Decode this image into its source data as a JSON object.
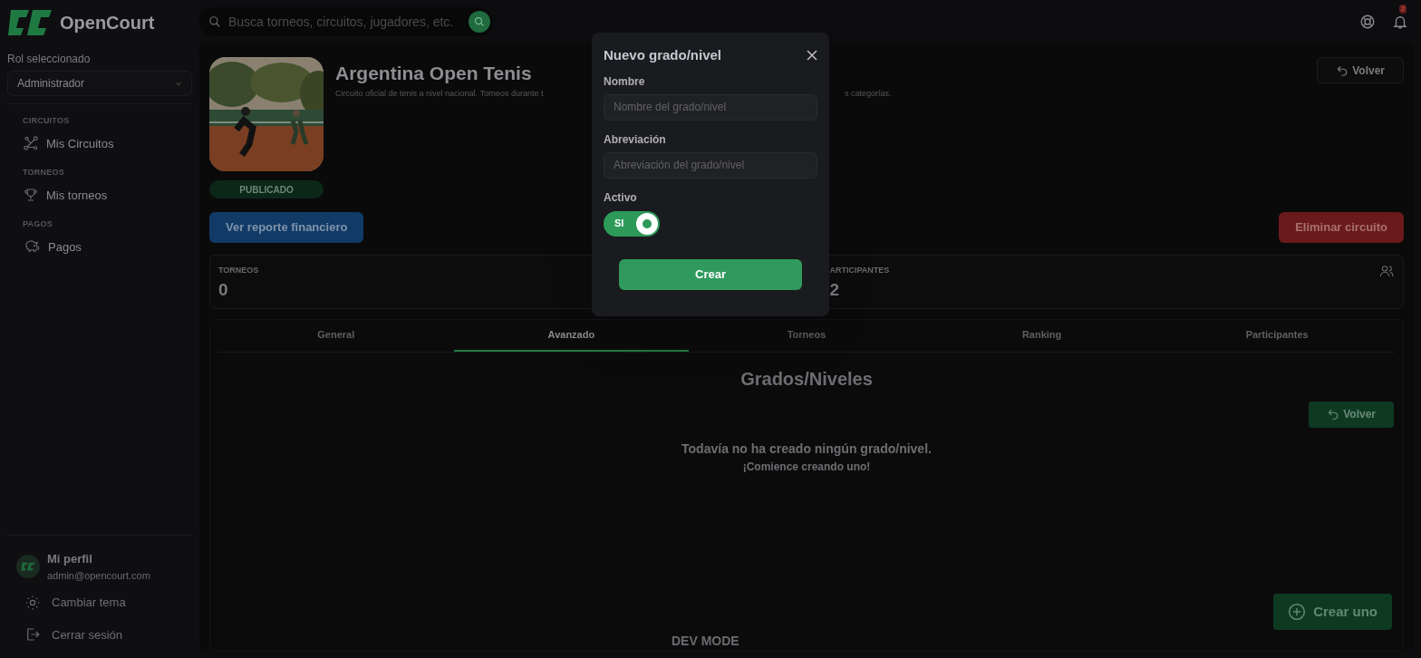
{
  "brand": {
    "name": "OpenCourt"
  },
  "search": {
    "placeholder": "Busca torneos, circuitos, jugadores, etc."
  },
  "notifications": {
    "count": "2"
  },
  "sidebar": {
    "role_label": "Rol seleccionado",
    "role_value": "Administrador",
    "sections": [
      {
        "title": "CIRCUITOS",
        "items": [
          {
            "label": "Mis Circuitos"
          }
        ]
      },
      {
        "title": "TORNEOS",
        "items": [
          {
            "label": "Mis torneos"
          }
        ]
      },
      {
        "title": "PAGOS",
        "items": [
          {
            "label": "Pagos"
          }
        ]
      }
    ],
    "profile": {
      "name": "Mi perfil",
      "email": "admin@opencourt.com"
    },
    "footer_items": [
      {
        "label": "Cambiar tema"
      },
      {
        "label": "Cerrar sesión"
      }
    ]
  },
  "circuit": {
    "title": "Argentina Open Tenis",
    "description_start": "Circuito oficial de tenis a nivel nacional. Torneos durante t",
    "description_end": "s categorías.",
    "status": "PUBLICADO",
    "back_button": "Volver",
    "report_button": "Ver reporte financiero",
    "delete_button": "Eliminar circuito"
  },
  "stats": [
    {
      "label": "TORNEOS",
      "value": "0"
    },
    {
      "label": "ARTICIPANTES",
      "value": "2"
    }
  ],
  "tabs": [
    {
      "label": "General",
      "selected": false
    },
    {
      "label": "Avanzado",
      "selected": true
    },
    {
      "label": "Torneos",
      "selected": false
    },
    {
      "label": "Ranking",
      "selected": false
    },
    {
      "label": "Participantes",
      "selected": false
    }
  ],
  "levels": {
    "title": "Grados/Niveles",
    "back_button": "Volver",
    "empty_title": "Todavía no ha creado ningún grado/nivel.",
    "empty_subtitle": "¡Comience creando uno!",
    "create_button": "Crear uno"
  },
  "dev_mode": "DEV MODE",
  "modal": {
    "title": "Nuevo grado/nivel",
    "fields": [
      {
        "label": "Nombre",
        "placeholder": "Nombre del grado/nivel"
      },
      {
        "label": "Abreviación",
        "placeholder": "Abreviación del grado/nivel"
      }
    ],
    "toggle": {
      "label": "Activo",
      "on": true,
      "text": "SI"
    },
    "submit": "Crear"
  }
}
